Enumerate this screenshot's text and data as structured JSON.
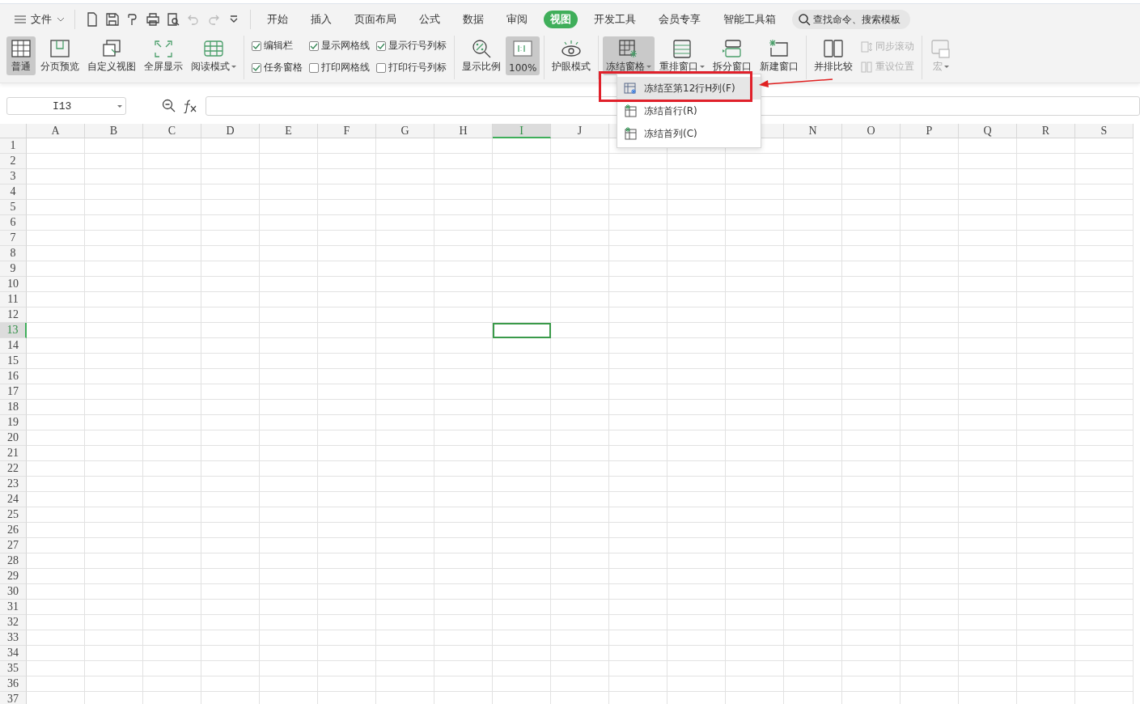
{
  "menu": {
    "file": "文件",
    "tabs": [
      {
        "label": "开始",
        "selected": false
      },
      {
        "label": "插入",
        "selected": false
      },
      {
        "label": "页面布局",
        "selected": false
      },
      {
        "label": "公式",
        "selected": false
      },
      {
        "label": "数据",
        "selected": false
      },
      {
        "label": "审阅",
        "selected": false
      },
      {
        "label": "视图",
        "selected": true
      },
      {
        "label": "开发工具",
        "selected": false
      },
      {
        "label": "会员专享",
        "selected": false
      },
      {
        "label": "智能工具箱",
        "selected": false
      }
    ],
    "search": {
      "placeholder": "查找命令、搜索模板"
    }
  },
  "ribbon": {
    "groups": [
      {
        "items": [
          {
            "kind": "big",
            "label": "普通",
            "selected": true,
            "disabled": false,
            "caret": false
          },
          {
            "kind": "big",
            "label": "分页预览",
            "selected": false,
            "disabled": false,
            "caret": false
          },
          {
            "kind": "big",
            "label": "自定义视图",
            "selected": false,
            "disabled": false,
            "caret": false
          },
          {
            "kind": "big",
            "label": "全屏显示",
            "selected": false,
            "disabled": false,
            "caret": false
          },
          {
            "kind": "big",
            "label": "阅读模式",
            "selected": false,
            "disabled": false,
            "caret": true
          }
        ]
      },
      {
        "items": [
          {
            "kind": "check",
            "label": "编辑栏",
            "checked": true
          },
          {
            "kind": "check",
            "label": "显示网格线",
            "checked": true
          },
          {
            "kind": "check",
            "label": "显示行号列标",
            "checked": true
          },
          {
            "kind": "check",
            "label": "任务窗格",
            "checked": true
          },
          {
            "kind": "check",
            "label": "打印网格线",
            "checked": false
          },
          {
            "kind": "check",
            "label": "打印行号列标",
            "checked": false
          }
        ]
      },
      {
        "items": [
          {
            "kind": "big",
            "label": "显示比例",
            "selected": false,
            "disabled": false,
            "caret": false
          },
          {
            "kind": "big",
            "label": "100%",
            "selected": true,
            "disabled": false,
            "caret": false
          }
        ]
      },
      {
        "items": [
          {
            "kind": "big",
            "label": "护眼模式",
            "selected": false,
            "disabled": false,
            "caret": false
          }
        ]
      },
      {
        "items": [
          {
            "kind": "big",
            "label": "冻结窗格",
            "selected": true,
            "disabled": false,
            "caret": true
          },
          {
            "kind": "big",
            "label": "重排窗口",
            "selected": false,
            "disabled": false,
            "caret": true
          },
          {
            "kind": "big",
            "label": "拆分窗口",
            "selected": false,
            "disabled": false,
            "caret": false
          },
          {
            "kind": "big",
            "label": "新建窗口",
            "selected": false,
            "disabled": false,
            "caret": false
          }
        ]
      },
      {
        "items": [
          {
            "kind": "big",
            "label": "并排比较",
            "selected": false,
            "disabled": false,
            "caret": false
          },
          {
            "kind": "small",
            "label": "同步滚动",
            "disabled": true
          },
          {
            "kind": "small",
            "label": "重设位置",
            "disabled": true
          }
        ]
      },
      {
        "items": [
          {
            "kind": "big",
            "label": "宏",
            "selected": false,
            "disabled": true,
            "caret": true
          }
        ]
      }
    ]
  },
  "dropdown": {
    "items": [
      {
        "label": "冻结至第12行H列(F)",
        "selected": true,
        "annotated": true
      },
      {
        "label": "冻结首行(R)",
        "selected": false,
        "annotated": false
      },
      {
        "label": "冻结首列(C)",
        "selected": false,
        "annotated": false
      }
    ]
  },
  "formula_bar": {
    "name_box": "I13"
  },
  "sheet": {
    "columns": [
      {
        "label": "A",
        "selected": false
      },
      {
        "label": "B",
        "selected": false
      },
      {
        "label": "C",
        "selected": false
      },
      {
        "label": "D",
        "selected": false
      },
      {
        "label": "E",
        "selected": false
      },
      {
        "label": "F",
        "selected": false
      },
      {
        "label": "G",
        "selected": false
      },
      {
        "label": "H",
        "selected": false
      },
      {
        "label": "I",
        "selected": true
      },
      {
        "label": "J",
        "selected": false
      },
      {
        "selected": false
      },
      {},
      {
        "selected": false
      },
      {
        "label": "N",
        "selected": false
      },
      {
        "label": "O",
        "selected": false
      },
      {
        "label": "P",
        "selected": false
      },
      {
        "label": "Q",
        "selected": false
      },
      {
        "label": "R",
        "selected": false
      },
      {
        "label": "S",
        "selected": false
      }
    ],
    "rows": [
      {
        "label": "1",
        "selected": false
      },
      {
        "label": "2",
        "selected": false
      },
      {
        "label": "3",
        "selected": false
      },
      {
        "label": "4",
        "selected": false
      },
      {
        "label": "5",
        "selected": false
      },
      {
        "label": "6",
        "selected": false
      },
      {
        "label": "7",
        "selected": false
      },
      {
        "label": "8",
        "selected": false
      },
      {
        "label": "9",
        "selected": false
      },
      {
        "label": "10",
        "selected": false
      },
      {
        "label": "11",
        "selected": false
      },
      {
        "label": "12",
        "selected": false
      },
      {
        "label": "13",
        "selected": true
      },
      {
        "label": "14",
        "selected": false
      },
      {
        "label": "15",
        "selected": false
      },
      {
        "label": "16",
        "selected": false
      },
      {
        "label": "17",
        "selected": false
      },
      {
        "label": "18",
        "selected": false
      },
      {
        "label": "19",
        "selected": false
      },
      {
        "label": "20",
        "selected": false
      },
      {
        "label": "21",
        "selected": false
      },
      {
        "label": "22",
        "selected": false
      },
      {
        "label": "23",
        "selected": false
      },
      {
        "label": "24",
        "selected": false
      },
      {
        "label": "25",
        "selected": false
      },
      {
        "label": "26",
        "selected": false
      },
      {
        "label": "27",
        "selected": false
      },
      {
        "label": "28",
        "selected": false
      },
      {
        "label": "29",
        "selected": false
      },
      {
        "label": "30",
        "selected": false
      },
      {
        "label": "31",
        "selected": false
      },
      {
        "label": "32",
        "selected": false
      },
      {
        "label": "33",
        "selected": false
      },
      {
        "label": "34",
        "selected": false
      },
      {
        "label": "35",
        "selected": false
      },
      {
        "label": "36",
        "selected": false
      },
      {
        "label": "37",
        "selected": false
      }
    ]
  }
}
